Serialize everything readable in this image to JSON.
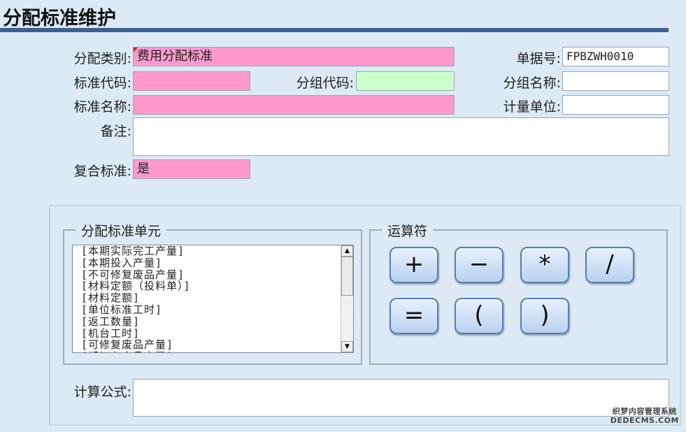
{
  "page": {
    "title": "分配标准维护"
  },
  "form": {
    "category": {
      "label": "分配类别:",
      "value": "费用分配标准"
    },
    "doc_no": {
      "label": "单据号:",
      "value": "FPBZWH0010"
    },
    "std_code": {
      "label": "标准代码:",
      "value": ""
    },
    "group_code": {
      "label": "分组代码:",
      "value": ""
    },
    "group_name": {
      "label": "分组名称:",
      "value": ""
    },
    "std_name": {
      "label": "标准名称:",
      "value": ""
    },
    "unit": {
      "label": "计量单位:",
      "value": ""
    },
    "remark": {
      "label": "备注:",
      "value": ""
    },
    "composite": {
      "label": "复合标准:",
      "value": "是"
    }
  },
  "units_group": {
    "title": "分配标准单元",
    "items": [
      "[本期实际完工产量]",
      "[本期投入产量]",
      "[不可修复废品产量]",
      "[材料定额（投料单）]",
      "[材料定额]",
      "[单位标准工时]",
      "[返工数量]",
      "[机台工时]",
      "[可修复废品产量]",
      "[期初在产品产量]"
    ]
  },
  "operators_group": {
    "title": "运算符",
    "buttons": [
      "+",
      "−",
      "*",
      "/",
      "=",
      "(",
      ")"
    ]
  },
  "formula": {
    "label": "计算公式:",
    "value": ""
  },
  "watermark": {
    "line1": "织梦内容管理系统",
    "line2": "DEDECMS.COM"
  },
  "colors": {
    "required_field": "#ff99cc",
    "code_field": "#ccffcc",
    "title_bar": "#3a5f91",
    "background": "#dde9f4"
  }
}
